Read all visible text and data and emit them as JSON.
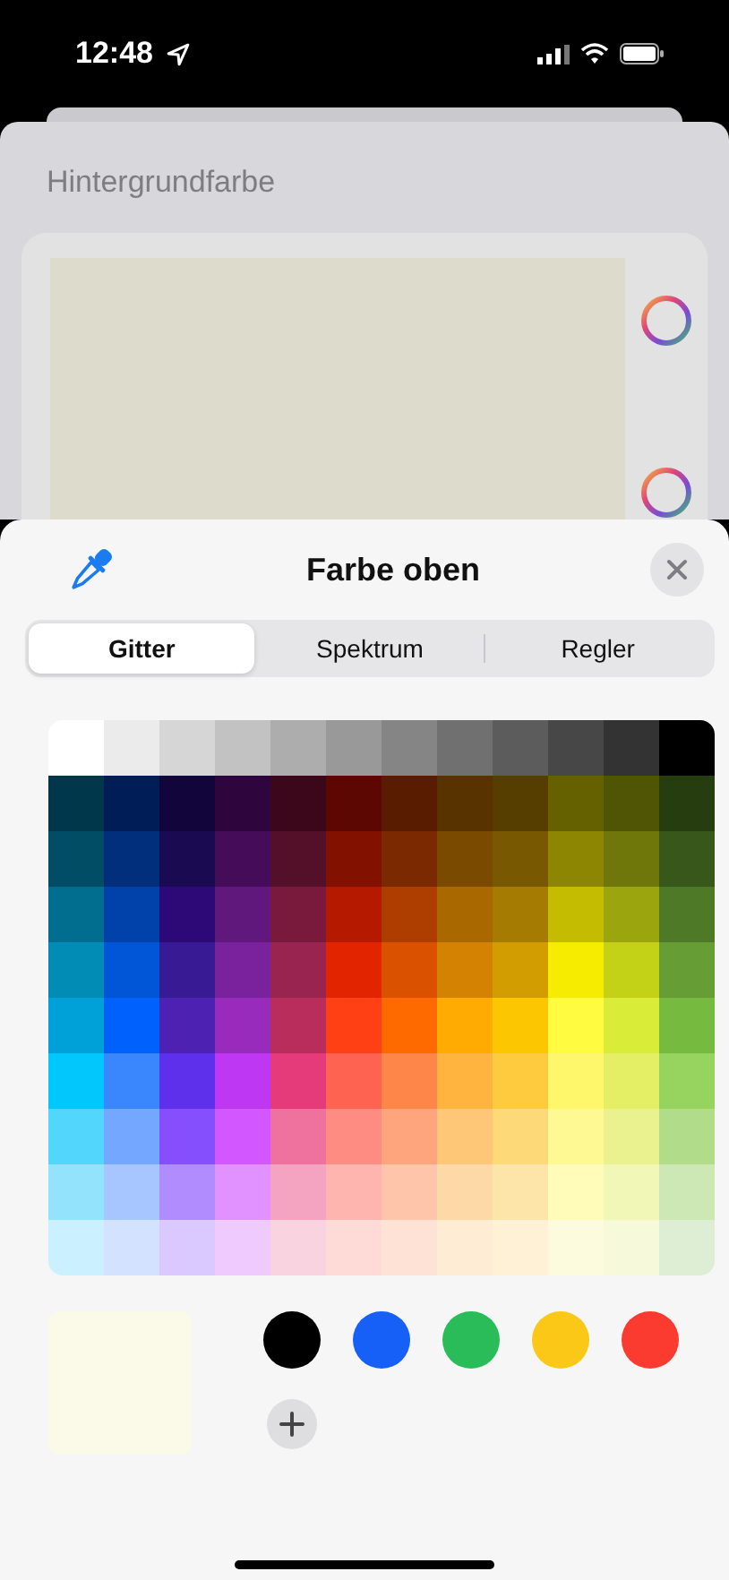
{
  "status_bar": {
    "time": "12:48"
  },
  "background_sheet": {
    "title": "Hintergrundfarbe"
  },
  "picker": {
    "title": "Farbe oben",
    "tabs": [
      {
        "label": "Gitter",
        "selected": true
      },
      {
        "label": "Spektrum",
        "selected": false
      },
      {
        "label": "Regler",
        "selected": false
      }
    ],
    "grid": [
      {
        "cells": [
          {
            "color": "#ffffff"
          },
          {
            "color": "#ebebeb"
          },
          {
            "color": "#d6d6d6"
          },
          {
            "color": "#c2c2c2"
          },
          {
            "color": "#adadad"
          },
          {
            "color": "#999999"
          },
          {
            "color": "#858585"
          },
          {
            "color": "#707070"
          },
          {
            "color": "#5c5c5c"
          },
          {
            "color": "#474747"
          },
          {
            "color": "#333333"
          },
          {
            "color": "#000000"
          }
        ]
      },
      {
        "cells": [
          {
            "color": "#00374a"
          },
          {
            "color": "#011d57"
          },
          {
            "color": "#11053b"
          },
          {
            "color": "#2e063d"
          },
          {
            "color": "#3c071b"
          },
          {
            "color": "#5c0701"
          },
          {
            "color": "#5a1c00"
          },
          {
            "color": "#583300"
          },
          {
            "color": "#563d00"
          },
          {
            "color": "#666100"
          },
          {
            "color": "#4f5504"
          },
          {
            "color": "#263e0f"
          }
        ]
      },
      {
        "cells": [
          {
            "color": "#004d65"
          },
          {
            "color": "#012f7b"
          },
          {
            "color": "#1a0a52"
          },
          {
            "color": "#450d59"
          },
          {
            "color": "#551029"
          },
          {
            "color": "#831100"
          },
          {
            "color": "#7b2900"
          },
          {
            "color": "#7a4a00"
          },
          {
            "color": "#785800"
          },
          {
            "color": "#8d8602"
          },
          {
            "color": "#6f760a"
          },
          {
            "color": "#38571a"
          }
        ]
      },
      {
        "cells": [
          {
            "color": "#016e8f"
          },
          {
            "color": "#0042a9"
          },
          {
            "color": "#2c0977"
          },
          {
            "color": "#61187c"
          },
          {
            "color": "#791a3d"
          },
          {
            "color": "#b51a00"
          },
          {
            "color": "#ad3e00"
          },
          {
            "color": "#a96800"
          },
          {
            "color": "#a67b01"
          },
          {
            "color": "#c4bc00"
          },
          {
            "color": "#9ba50e"
          },
          {
            "color": "#4e7a27"
          }
        ]
      },
      {
        "cells": [
          {
            "color": "#008cb4"
          },
          {
            "color": "#0056d6"
          },
          {
            "color": "#371a94"
          },
          {
            "color": "#7a219e"
          },
          {
            "color": "#99244f"
          },
          {
            "color": "#e22400"
          },
          {
            "color": "#da5100"
          },
          {
            "color": "#d38301"
          },
          {
            "color": "#d19d01"
          },
          {
            "color": "#f5ec00"
          },
          {
            "color": "#c3d117"
          },
          {
            "color": "#669d34"
          }
        ]
      },
      {
        "cells": [
          {
            "color": "#00a1d8"
          },
          {
            "color": "#0061fd"
          },
          {
            "color": "#4d22b2"
          },
          {
            "color": "#982abc"
          },
          {
            "color": "#b92d5d"
          },
          {
            "color": "#ff4015"
          },
          {
            "color": "#ff6a00"
          },
          {
            "color": "#ffab01"
          },
          {
            "color": "#fcc700"
          },
          {
            "color": "#fefb41"
          },
          {
            "color": "#d9ec37"
          },
          {
            "color": "#76bb40"
          }
        ]
      },
      {
        "cells": [
          {
            "color": "#01c7fc"
          },
          {
            "color": "#3a87fd"
          },
          {
            "color": "#5e30eb"
          },
          {
            "color": "#be38f3"
          },
          {
            "color": "#e63b7a"
          },
          {
            "color": "#fe6250"
          },
          {
            "color": "#fe8648"
          },
          {
            "color": "#feb43f"
          },
          {
            "color": "#fecb3e"
          },
          {
            "color": "#fff76b"
          },
          {
            "color": "#e4ef65"
          },
          {
            "color": "#96d35f"
          }
        ]
      },
      {
        "cells": [
          {
            "color": "#52d6fc"
          },
          {
            "color": "#74a7ff"
          },
          {
            "color": "#864ffd"
          },
          {
            "color": "#d357fe"
          },
          {
            "color": "#ee719e"
          },
          {
            "color": "#ff8c82"
          },
          {
            "color": "#fea57d"
          },
          {
            "color": "#fec777"
          },
          {
            "color": "#fed977"
          },
          {
            "color": "#fff994"
          },
          {
            "color": "#eaf28f"
          },
          {
            "color": "#b1dd8b"
          }
        ]
      },
      {
        "cells": [
          {
            "color": "#93e3fc"
          },
          {
            "color": "#a7c6ff"
          },
          {
            "color": "#b18cfe"
          },
          {
            "color": "#e292fe"
          },
          {
            "color": "#f4a4c0"
          },
          {
            "color": "#ffb5af"
          },
          {
            "color": "#ffc5ab"
          },
          {
            "color": "#fed9a8"
          },
          {
            "color": "#fde4a8"
          },
          {
            "color": "#fffbb9"
          },
          {
            "color": "#f1f7b7"
          },
          {
            "color": "#cde8b5"
          }
        ]
      },
      {
        "cells": [
          {
            "color": "#cbf0ff"
          },
          {
            "color": "#d3e2ff"
          },
          {
            "color": "#d9c9fe"
          },
          {
            "color": "#efcaff"
          },
          {
            "color": "#f9d3e0"
          },
          {
            "color": "#ffdbd8"
          },
          {
            "color": "#ffe2d6"
          },
          {
            "color": "#feecd4"
          },
          {
            "color": "#fef1d5"
          },
          {
            "color": "#fdfbdd"
          },
          {
            "color": "#f6fadb"
          },
          {
            "color": "#deeed4"
          }
        ]
      }
    ],
    "current": {
      "color": "#fbf9e8"
    },
    "swatches": [
      {
        "color": "#000000"
      },
      {
        "color": "#1660f8"
      },
      {
        "color": "#2bbc5a"
      },
      {
        "color": "#fcc818"
      },
      {
        "color": "#fb3b30"
      }
    ]
  }
}
